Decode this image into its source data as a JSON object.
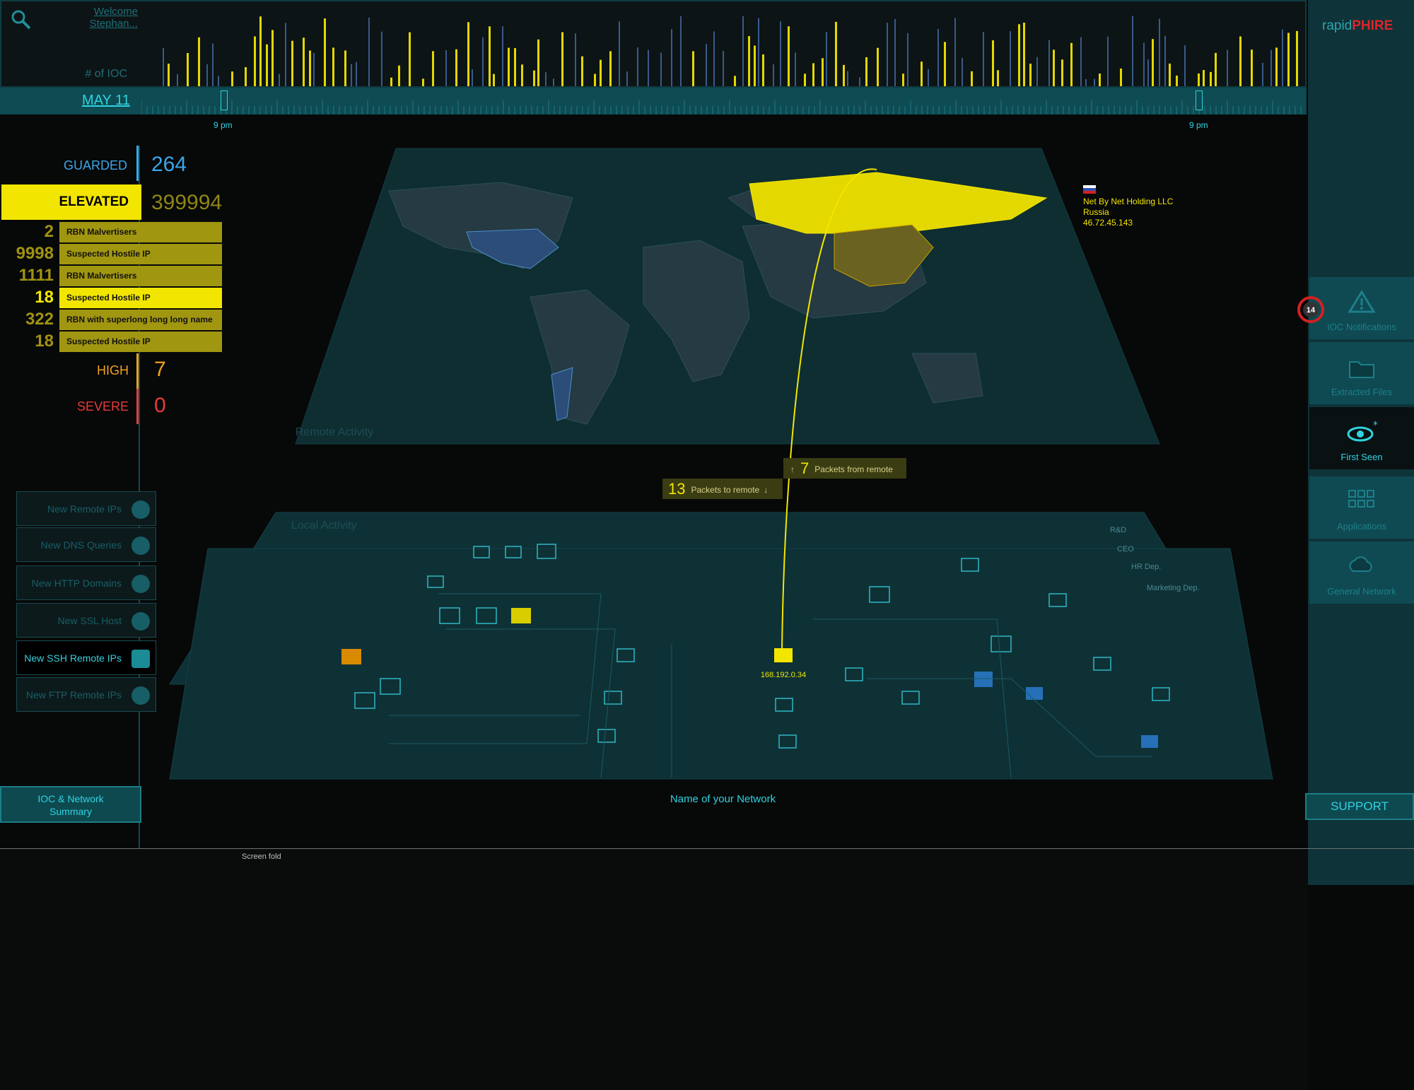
{
  "header": {
    "welcome_line1": "Welcome",
    "welcome_line2": "Stephan...",
    "ioc_axis_label": "# of IOC",
    "date_label": "MAY 11",
    "time_marks": [
      "9 pm",
      "9 pm"
    ]
  },
  "brand": {
    "prefix": "rapid",
    "suffix": "PHIRE"
  },
  "threat_levels": {
    "guarded": {
      "label": "GUARDED",
      "value": "264"
    },
    "elevated": {
      "label": "ELEVATED",
      "value": "399994"
    },
    "high": {
      "label": "HIGH",
      "value": "7"
    },
    "severe": {
      "label": "SEVERE",
      "value": "0"
    }
  },
  "ioc_list": [
    {
      "count": "2",
      "name": "RBN Malvertisers"
    },
    {
      "count": "9998",
      "name": "Suspected Hostile IP"
    },
    {
      "count": "1111",
      "name": "RBN Malvertisers"
    },
    {
      "count": "18",
      "name": "Suspected Hostile IP"
    },
    {
      "count": "322",
      "name": "RBN with superlong long long name"
    },
    {
      "count": "18",
      "name": "Suspected Hostile IP"
    }
  ],
  "filters": [
    {
      "label": "New Remote IPs",
      "icon": "monitor-icon"
    },
    {
      "label": "New DNS Queries",
      "icon": "info-icon"
    },
    {
      "label": "New HTTP Domains",
      "icon": "globe-icon"
    },
    {
      "label": "New SSL Host",
      "icon": "lock-icon"
    },
    {
      "label": "New SSH Remote IPs",
      "icon": "terminal-icon"
    },
    {
      "label": "New FTP Remote IPs",
      "icon": "folder-icon"
    }
  ],
  "summary_button": {
    "line1": "IOC & Network",
    "line2": "Summary"
  },
  "map": {
    "remote_label": "Remote Activity",
    "local_label": "Local Activity",
    "network_name": "Name of your Network",
    "tooltip": {
      "org": "Net By Net Holding LLC",
      "country": "Russia",
      "ip": "46.72.45.143"
    },
    "packets_from": {
      "count": "7",
      "label": "Packets from remote"
    },
    "packets_to": {
      "count": "13",
      "label": "Packets to remote"
    },
    "local_node_ip": "168.192.0.34",
    "legend": [
      "R&D",
      "CEO",
      "HR Dep.",
      "Marketing Dep."
    ]
  },
  "right_nav": {
    "notification_count": "14",
    "items": [
      {
        "label": "IOC Notifications",
        "icon": "warning-icon"
      },
      {
        "label": "Extracted Files",
        "icon": "folder-icon"
      },
      {
        "label": "First Seen",
        "icon": "eye-icon"
      },
      {
        "label": "Applications",
        "icon": "grid-icon"
      },
      {
        "label": "General Network",
        "icon": "cloud-icon"
      }
    ],
    "support_label": "SUPPORT"
  },
  "fold_label": "Screen fold",
  "colors": {
    "accent": "#2fd3e0",
    "elevated": "#f2e600",
    "high": "#f0a020",
    "severe": "#e83a3a",
    "guarded": "#3aa6e8"
  }
}
